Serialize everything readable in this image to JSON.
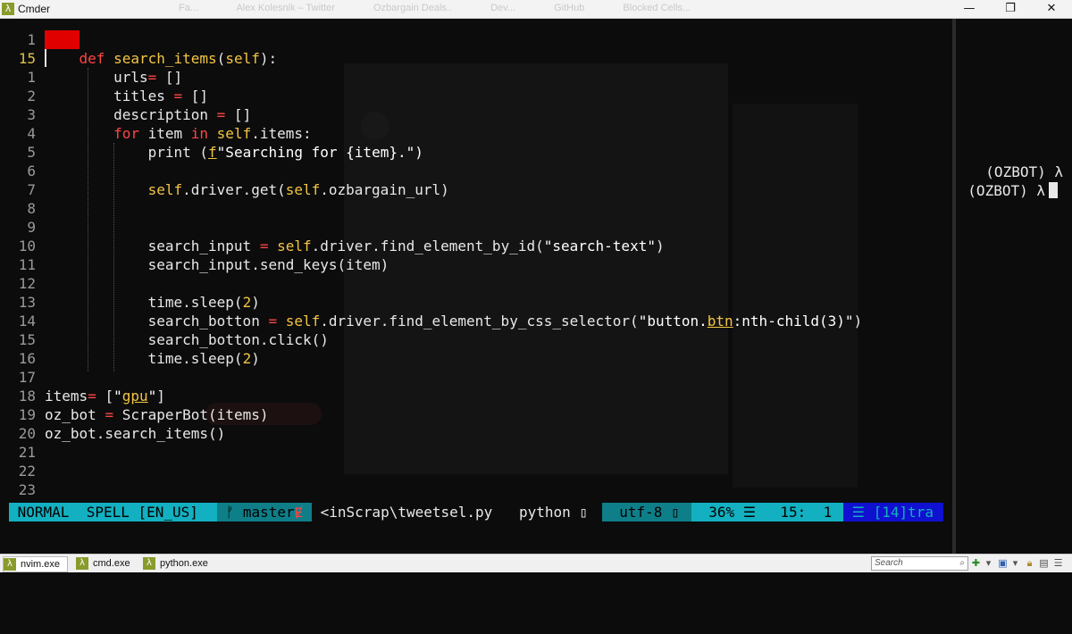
{
  "window": {
    "title": "Cmder",
    "ghost_tabs": [
      "Fa...",
      "Alex Kolesnik – Twitter",
      "Ozbargain Deals..",
      "Dev...",
      "GitHub",
      "Blocked Cells..."
    ]
  },
  "title_controls": {
    "minimize": "—",
    "restore": "❐",
    "close": "✕"
  },
  "editor": {
    "lines": [
      {
        "num": "1",
        "current": false,
        "segments": []
      },
      {
        "num": "15",
        "current": true,
        "segments": [
          {
            "t": "    "
          },
          {
            "t": "def",
            "c": "kw"
          },
          {
            "t": " "
          },
          {
            "t": "search_items",
            "c": "fn"
          },
          {
            "t": "("
          },
          {
            "t": "self",
            "c": "slf"
          },
          {
            "t": "):"
          }
        ]
      },
      {
        "num": "1",
        "current": false,
        "segments": [
          {
            "t": "        urls"
          },
          {
            "t": "=",
            "c": "op"
          },
          {
            "t": " []"
          }
        ]
      },
      {
        "num": "2",
        "current": false,
        "segments": [
          {
            "t": "        titles "
          },
          {
            "t": "=",
            "c": "op"
          },
          {
            "t": " []"
          }
        ]
      },
      {
        "num": "3",
        "current": false,
        "segments": [
          {
            "t": "        description "
          },
          {
            "t": "=",
            "c": "op"
          },
          {
            "t": " []"
          }
        ]
      },
      {
        "num": "4",
        "current": false,
        "segments": [
          {
            "t": "        "
          },
          {
            "t": "for",
            "c": "kw"
          },
          {
            "t": " item "
          },
          {
            "t": "in",
            "c": "kw"
          },
          {
            "t": " "
          },
          {
            "t": "self",
            "c": "slf"
          },
          {
            "t": ".items:"
          }
        ]
      },
      {
        "num": "5",
        "current": false,
        "segments": [
          {
            "t": "            print ("
          },
          {
            "t": "f",
            "c": "und"
          },
          {
            "t": "\"Searching for {item}.\")",
            "c": "str"
          }
        ]
      },
      {
        "num": "6",
        "current": false,
        "segments": []
      },
      {
        "num": "7",
        "current": false,
        "segments": [
          {
            "t": "            "
          },
          {
            "t": "self",
            "c": "slf"
          },
          {
            "t": ".driver.get("
          },
          {
            "t": "self",
            "c": "slf"
          },
          {
            "t": ".ozbargain_url)"
          }
        ]
      },
      {
        "num": "8",
        "current": false,
        "segments": []
      },
      {
        "num": "9",
        "current": false,
        "segments": []
      },
      {
        "num": "10",
        "current": false,
        "segments": [
          {
            "t": "            search_input "
          },
          {
            "t": "=",
            "c": "op"
          },
          {
            "t": " "
          },
          {
            "t": "self",
            "c": "slf"
          },
          {
            "t": ".driver.find_element_by_id("
          },
          {
            "t": "\"search-text\"",
            "c": "str"
          },
          {
            "t": ")"
          }
        ]
      },
      {
        "num": "11",
        "current": false,
        "segments": [
          {
            "t": "            search_input.send_keys(item)"
          }
        ]
      },
      {
        "num": "12",
        "current": false,
        "segments": []
      },
      {
        "num": "13",
        "current": false,
        "segments": [
          {
            "t": "            time.sleep("
          },
          {
            "t": "2",
            "c": "num"
          },
          {
            "t": ")"
          }
        ]
      },
      {
        "num": "14",
        "current": false,
        "segments": [
          {
            "t": "            search_botton "
          },
          {
            "t": "=",
            "c": "op"
          },
          {
            "t": " "
          },
          {
            "t": "self",
            "c": "slf"
          },
          {
            "t": ".driver.find_element_by_css_selector("
          },
          {
            "t": "\"button.",
            "c": "str"
          },
          {
            "t": "btn",
            "c": "und"
          },
          {
            "t": ":nth-child(3)\"",
            "c": "str"
          },
          {
            "t": ")"
          }
        ]
      },
      {
        "num": "15",
        "current": false,
        "segments": [
          {
            "t": "            search_botton.click()"
          }
        ]
      },
      {
        "num": "16",
        "current": false,
        "segments": [
          {
            "t": "            time.sleep("
          },
          {
            "t": "2",
            "c": "num"
          },
          {
            "t": ")"
          }
        ]
      },
      {
        "num": "17",
        "current": false,
        "segments": []
      },
      {
        "num": "18",
        "current": false,
        "segments": [
          {
            "t": "items"
          },
          {
            "t": "=",
            "c": "op"
          },
          {
            "t": " ["
          },
          {
            "t": "\"",
            "c": "str"
          },
          {
            "t": "gpu",
            "c": "und"
          },
          {
            "t": "\"",
            "c": "str"
          },
          {
            "t": "]"
          }
        ]
      },
      {
        "num": "19",
        "current": false,
        "segments": [
          {
            "t": "oz_bot "
          },
          {
            "t": "=",
            "c": "op"
          },
          {
            "t": " ScraperBot(items)"
          }
        ]
      },
      {
        "num": "20",
        "current": false,
        "segments": [
          {
            "t": "oz_bot.search_items()"
          }
        ]
      },
      {
        "num": "21",
        "current": false,
        "segments": []
      },
      {
        "num": "22",
        "current": false,
        "segments": []
      },
      {
        "num": "23",
        "current": false,
        "segments": []
      }
    ]
  },
  "statusline": {
    "mode": " NORMAL  SPELL [EN_US]",
    "branch": " ᚠ master",
    "branch_flag": "Ɇ",
    "file": " <inScrap\\tweetsel.py",
    "filetype": "python ▯",
    "encoding": "  utf-8 ▯",
    "percent": "  36% ☰",
    "position": "  15:  1",
    "warnings": " ☰ [14]tra"
  },
  "terminal": {
    "line1": "(OZBOT) λ",
    "line2": "(OZBOT) λ"
  },
  "taskbar": {
    "tabs": [
      {
        "label": "nvim.exe",
        "active": true
      },
      {
        "label": "cmd.exe",
        "active": false
      },
      {
        "label": "python.exe",
        "active": false
      }
    ],
    "lambda": "λ",
    "search_placeholder": "Search"
  },
  "colors": {
    "accent": "#12b0c0",
    "keyword": "#ff4444",
    "function": "#f4c542",
    "cursor": "#e00000"
  }
}
